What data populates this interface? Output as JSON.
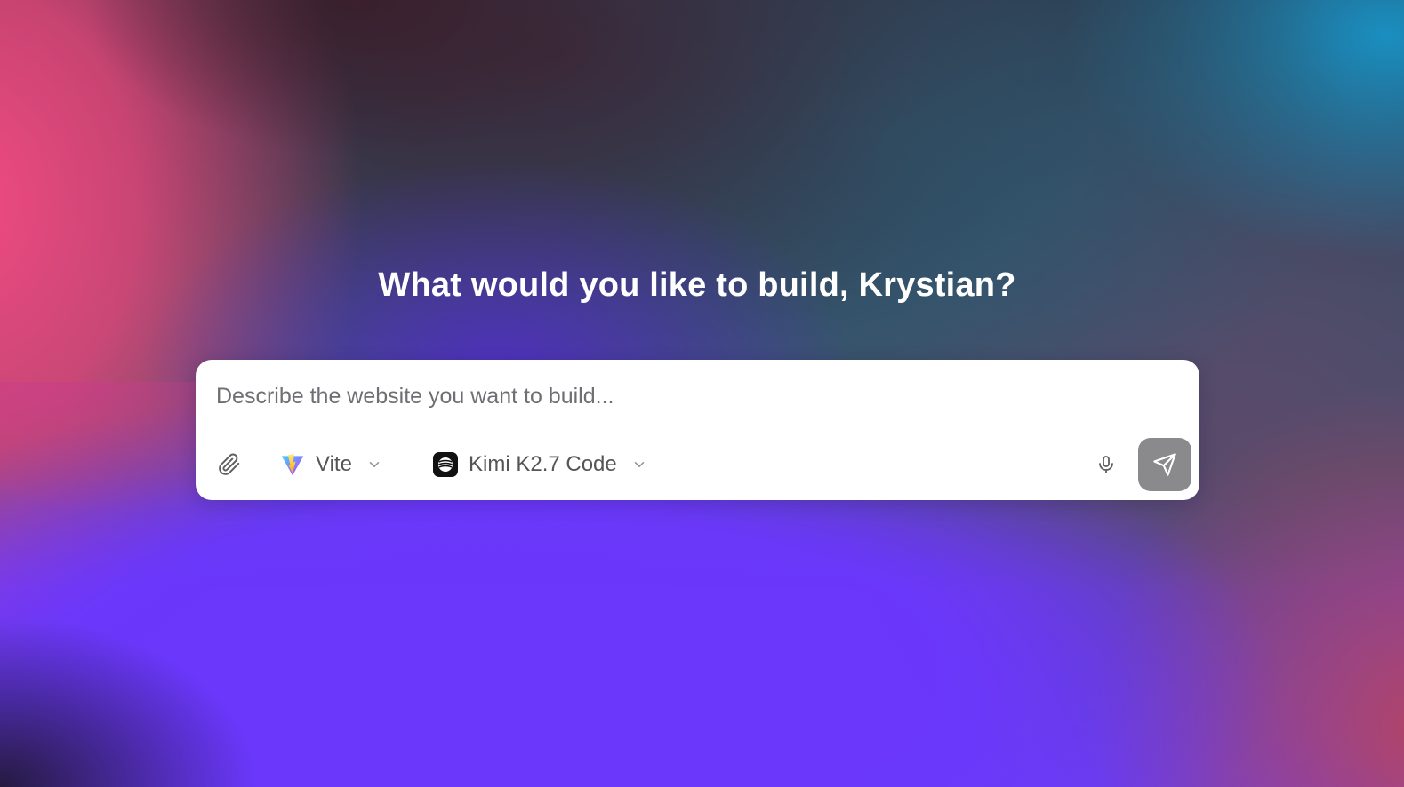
{
  "greeting": {
    "title": "What would you like to build, Krystian?"
  },
  "composer": {
    "placeholder": "Describe the website you want to build...",
    "value": ""
  },
  "toolbar": {
    "attach_icon": "paperclip-icon",
    "framework": {
      "label": "Vite",
      "icon": "vite-logo-icon"
    },
    "model": {
      "label": "Kimi K2.7 Code",
      "icon": "kimi-logo-icon"
    },
    "mic_icon": "microphone-icon",
    "send_icon": "send-icon"
  },
  "colors": {
    "send_button_bg": "#8a8a8c",
    "panel_bg": "#ffffff",
    "headline_text": "#ffffff",
    "bg_purple": "#6a37fb",
    "bg_pink": "#f14a82",
    "bg_teal": "#1a8fc0"
  }
}
